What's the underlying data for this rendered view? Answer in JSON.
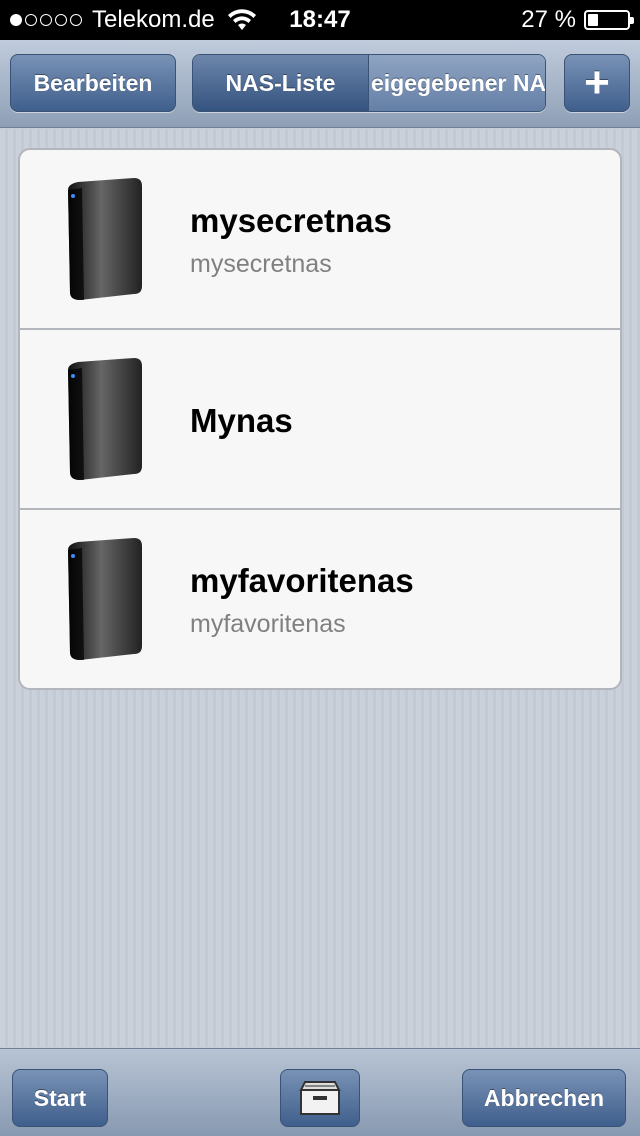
{
  "status_bar": {
    "signal_dots": [
      true,
      false,
      false,
      false,
      false
    ],
    "carrier": "Telekom.de",
    "time": "18:47",
    "battery_text": "27 %",
    "battery_level": 0.27
  },
  "nav": {
    "edit_label": "Bearbeiten",
    "segments": [
      "NAS-Liste",
      "eigegebener NAS"
    ],
    "selected_segment": 0,
    "add_label": "+"
  },
  "nas_list": [
    {
      "name": "mysecretnas",
      "subtitle": "mysecretnas"
    },
    {
      "name": "Mynas",
      "subtitle": ""
    },
    {
      "name": "myfavoritenas",
      "subtitle": "myfavoritenas"
    }
  ],
  "toolbar": {
    "start_label": "Start",
    "archive_icon": "archive-box-icon",
    "cancel_label": "Abbrechen"
  }
}
